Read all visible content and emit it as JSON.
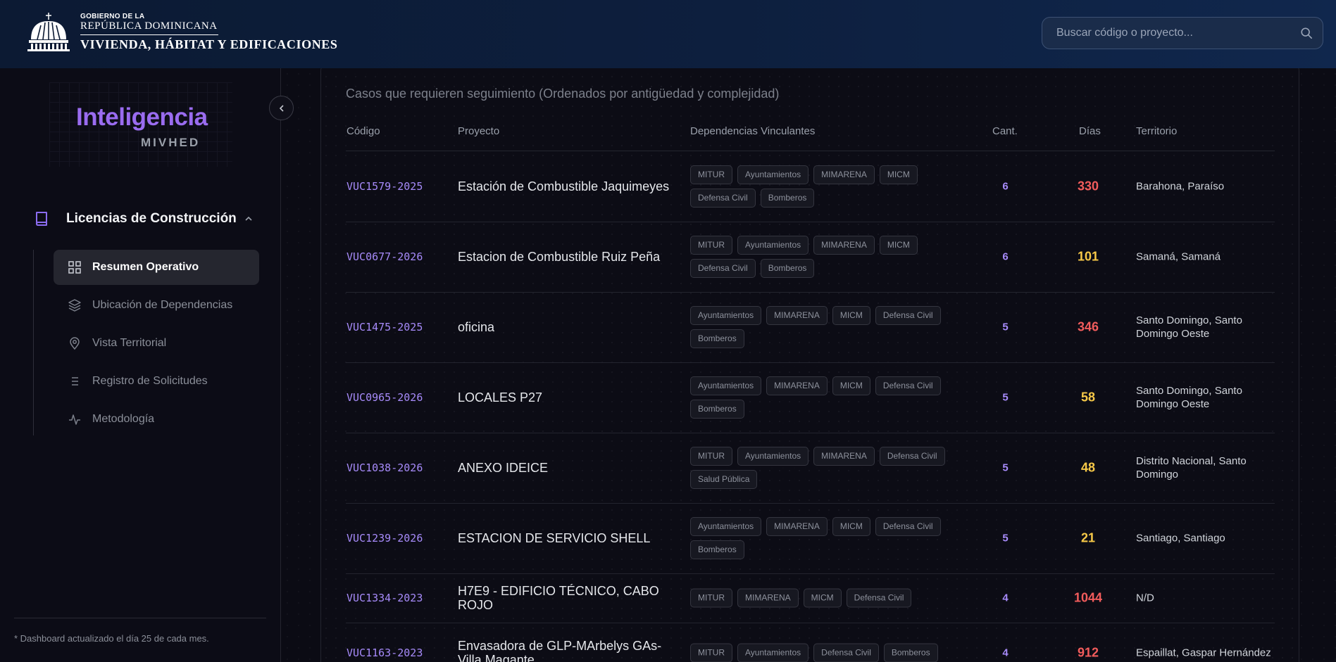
{
  "header": {
    "gov_line1": "GOBIERNO DE LA",
    "gov_line2": "REPÚBLICA DOMINICANA",
    "ministry": "VIVIENDA, HÁBITAT Y EDIFICACIONES",
    "search_placeholder": "Buscar código o proyecto..."
  },
  "sidebar": {
    "brand_title": "Inteligencia",
    "brand_subtitle": "MIVHED",
    "section_label": "Licencias de Construcción",
    "items": [
      {
        "label": "Resumen Operativo",
        "icon": "dashboard-grid-icon",
        "active": true
      },
      {
        "label": "Ubicación de Dependencias",
        "icon": "layers-icon",
        "active": false
      },
      {
        "label": "Vista Territorial",
        "icon": "map-pin-icon",
        "active": false
      },
      {
        "label": "Registro de Solicitudes",
        "icon": "list-icon",
        "active": false
      },
      {
        "label": "Metodología",
        "icon": "activity-icon",
        "active": false
      }
    ],
    "footnote": "* Dashboard actualizado el día 25 de cada mes."
  },
  "table": {
    "title": "Casos que requieren seguimiento (Ordenados por antigüedad y complejidad)",
    "headers": {
      "codigo": "Código",
      "proyecto": "Proyecto",
      "dependencias": "Dependencias Vinculantes",
      "cant": "Cant.",
      "dias": "Días",
      "territorio": "Territorio"
    },
    "rows": [
      {
        "code": "VUC1579-2025",
        "project": "Estación de Combustible Jaquimeyes",
        "deps": [
          "MITUR",
          "Ayuntamientos",
          "MIMARENA",
          "MICM",
          "Defensa Civil",
          "Bomberos"
        ],
        "cant": "6",
        "dias": "330",
        "dias_color": "#f25c5c",
        "territory": "Barahona, Paraíso"
      },
      {
        "code": "VUC0677-2026",
        "project": "Estacion de Combustible Ruiz Peña",
        "deps": [
          "MITUR",
          "Ayuntamientos",
          "MIMARENA",
          "MICM",
          "Defensa Civil",
          "Bomberos"
        ],
        "cant": "6",
        "dias": "101",
        "dias_color": "#f7c948",
        "territory": "Samaná, Samaná"
      },
      {
        "code": "VUC1475-2025",
        "project": "oficina",
        "deps": [
          "Ayuntamientos",
          "MIMARENA",
          "MICM",
          "Defensa Civil",
          "Bomberos"
        ],
        "cant": "5",
        "dias": "346",
        "dias_color": "#f25c5c",
        "territory": "Santo Domingo, Santo Domingo Oeste"
      },
      {
        "code": "VUC0965-2026",
        "project": "LOCALES P27",
        "deps": [
          "Ayuntamientos",
          "MIMARENA",
          "MICM",
          "Defensa Civil",
          "Bomberos"
        ],
        "cant": "5",
        "dias": "58",
        "dias_color": "#f7c948",
        "territory": "Santo Domingo, Santo Domingo Oeste"
      },
      {
        "code": "VUC1038-2026",
        "project": "ANEXO IDEICE",
        "deps": [
          "MITUR",
          "Ayuntamientos",
          "MIMARENA",
          "Defensa Civil",
          "Salud Pública"
        ],
        "cant": "5",
        "dias": "48",
        "dias_color": "#f7c948",
        "territory": "Distrito Nacional, Santo Domingo"
      },
      {
        "code": "VUC1239-2026",
        "project": "ESTACION DE SERVICIO SHELL",
        "deps": [
          "Ayuntamientos",
          "MIMARENA",
          "MICM",
          "Defensa Civil",
          "Bomberos"
        ],
        "cant": "5",
        "dias": "21",
        "dias_color": "#f7c948",
        "territory": "Santiago, Santiago"
      },
      {
        "code": "VUC1334-2023",
        "project": "H7E9 - EDIFICIO TÉCNICO, CABO ROJO",
        "deps": [
          "MITUR",
          "MIMARENA",
          "MICM",
          "Defensa Civil"
        ],
        "cant": "4",
        "dias": "1044",
        "dias_color": "#f25c5c",
        "territory": "N/D"
      },
      {
        "code": "VUC1163-2023",
        "project": "Envasadora de GLP-MArbelys GAs-Villa Magante",
        "deps": [
          "MITUR",
          "Ayuntamientos",
          "Defensa Civil",
          "Bomberos"
        ],
        "cant": "4",
        "dias": "912",
        "dias_color": "#f25c5c",
        "territory": "Espaillat, Gaspar Hernández"
      }
    ]
  }
}
